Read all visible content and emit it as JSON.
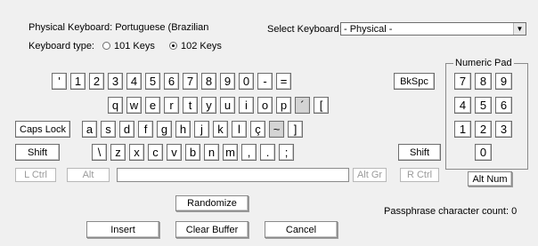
{
  "header": {
    "physical_keyboard_label": "Physical Keyboard: Portuguese (Brazilian",
    "select_keyboard_label": "Select Keyboard:",
    "select_keyboard_value": "- Physical -",
    "keyboard_type_label": "Keyboard type:",
    "type_options": [
      "101 Keys",
      "102 Keys"
    ],
    "selected_type": "102 Keys"
  },
  "keyboard": {
    "row1": [
      "'",
      "1",
      "2",
      "3",
      "4",
      "5",
      "6",
      "7",
      "8",
      "9",
      "0",
      "-",
      "="
    ],
    "row2": [
      "q",
      "w",
      "e",
      "r",
      "t",
      "y",
      "u",
      "i",
      "o",
      "p",
      "´",
      "["
    ],
    "row3": [
      "a",
      "s",
      "d",
      "f",
      "g",
      "h",
      "j",
      "k",
      "l",
      "ç",
      "~",
      "]"
    ],
    "row4": [
      "\\",
      "z",
      "x",
      "c",
      "v",
      "b",
      "n",
      "m",
      ",",
      ".",
      ";"
    ],
    "bkspc": "BkSpc",
    "caps_lock": "Caps Lock",
    "shift_left": "Shift",
    "shift_right": "Shift",
    "l_ctrl": "L Ctrl",
    "alt": "Alt",
    "alt_gr": "Alt Gr",
    "r_ctrl": "R Ctrl",
    "highlighted_keys": [
      "´",
      "~"
    ]
  },
  "numpad": {
    "title": "Numeric Pad",
    "rows": [
      [
        "7",
        "8",
        "9"
      ],
      [
        "4",
        "5",
        "6"
      ],
      [
        "1",
        "2",
        "3"
      ],
      [
        "0"
      ]
    ],
    "alt_num": "Alt Num"
  },
  "actions": {
    "randomize": "Randomize",
    "insert": "Insert",
    "clear_buffer": "Clear Buffer",
    "cancel": "Cancel"
  },
  "status": {
    "passphrase_count": "Passphrase character count: 0"
  }
}
